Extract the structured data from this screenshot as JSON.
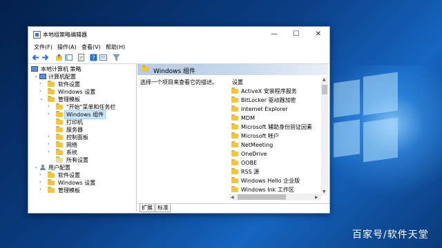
{
  "window": {
    "title": "本地组策略编辑器",
    "controls": {
      "minimize": "—",
      "maximize": "☐",
      "close": "✕"
    }
  },
  "menu": [
    "文件(F)",
    "操作(A)",
    "查看(V)",
    "帮助(H)"
  ],
  "toolbar_icons": [
    "back-icon",
    "forward-icon",
    "up-folder-icon",
    "show-hide-tree-icon",
    "export-icon",
    "help-icon",
    "properties-icon",
    "filter-icon"
  ],
  "tree": {
    "root": "本地计算机 策略",
    "computer": "计算机配置",
    "c_software": "软件设置",
    "c_windows": "Windows 设置",
    "c_admin": "管理模板",
    "start_menu": "\"开始\"菜单和任务栏",
    "windows_components": "Windows 组件",
    "printers": "打印机",
    "server": "服务器",
    "control_panel": "控制面板",
    "network": "网络",
    "system": "系统",
    "all_settings": "所有设置",
    "user": "用户配置",
    "u_software": "软件设置",
    "u_windows": "Windows 设置",
    "u_admin": "管理模板"
  },
  "right": {
    "header": "Windows 组件",
    "description": "选择一个项目来查看它的描述。",
    "column": "设置",
    "items": [
      "ActiveX 安装程序服务",
      "BitLocker 驱动器加密",
      "Internet Explorer",
      "MDM",
      "Microsoft 辅助身份验证因素",
      "Microsoft 帐户",
      "NetMeeting",
      "OneDrive",
      "OOBE",
      "RSS 源",
      "Windows Hello 企业版",
      "Windows Ink 工作区"
    ]
  },
  "tabs": [
    "扩展",
    "标准"
  ],
  "watermark": "百家号/软件天堂",
  "colors": {
    "selection": "#cce8ff",
    "header_gradient": "#b9cbe2",
    "folder": "#f3c43d",
    "desktop": "#0b3f86"
  }
}
